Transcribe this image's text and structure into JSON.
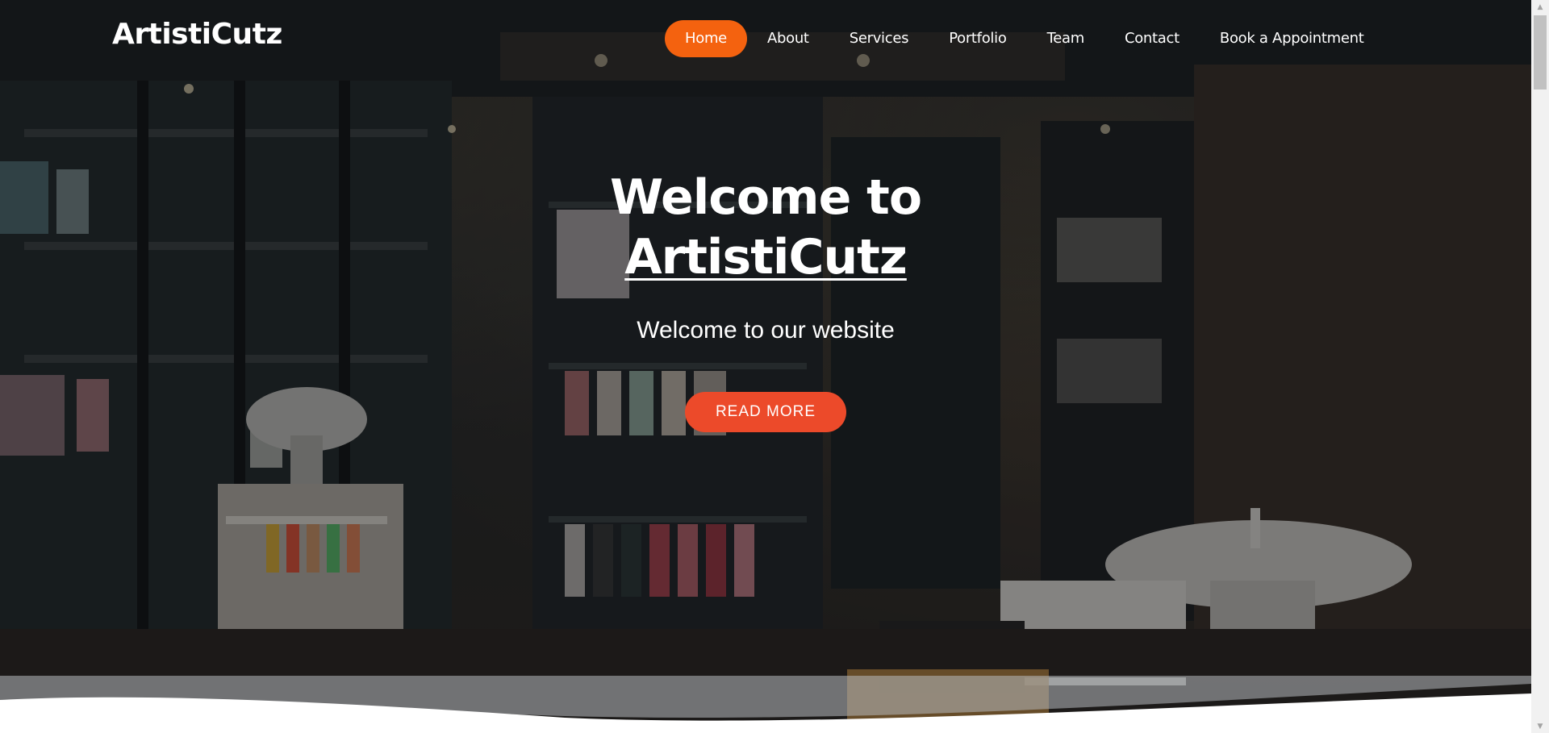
{
  "header": {
    "logo": "ArtistiCutz",
    "nav": [
      {
        "label": "Home",
        "active": true
      },
      {
        "label": "About",
        "active": false
      },
      {
        "label": "Services",
        "active": false
      },
      {
        "label": "Portfolio",
        "active": false
      },
      {
        "label": "Team",
        "active": false
      },
      {
        "label": "Contact",
        "active": false
      },
      {
        "label": "Book a Appointment",
        "active": false
      }
    ]
  },
  "hero": {
    "title_line1": "Welcome to",
    "title_brand": "ArtistiCutz",
    "subtitle": "Welcome to our website",
    "cta_label": "READ MORE"
  },
  "colors": {
    "accent": "#f4620f",
    "cta": "#ec4a2a",
    "text": "#ffffff"
  },
  "icons": {
    "scroll_up": "scroll-up-arrow-icon",
    "scroll_down": "scroll-down-arrow-icon"
  }
}
